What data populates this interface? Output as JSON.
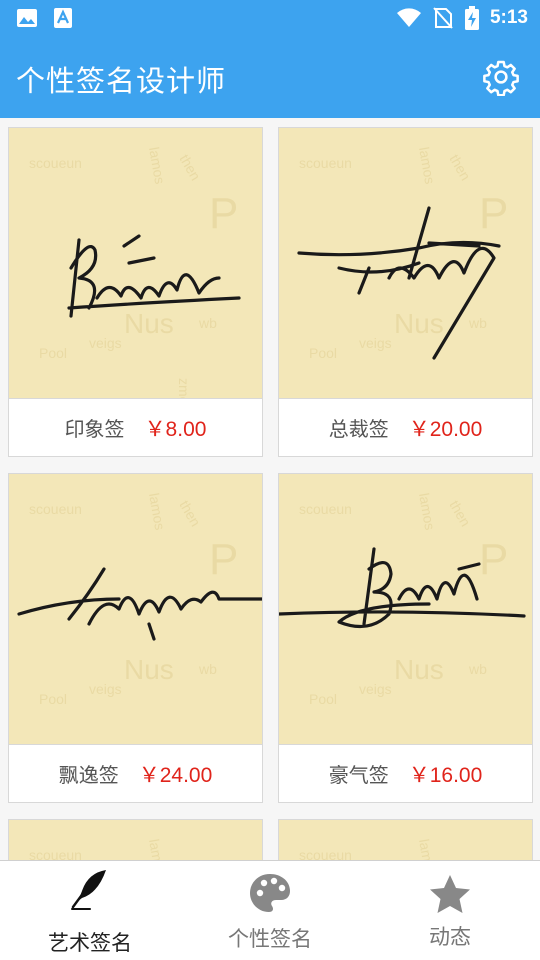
{
  "status_bar": {
    "time": "5:13",
    "icons": [
      "image-icon",
      "font-icon",
      "wifi-icon",
      "no-sim-icon",
      "battery-charging-icon"
    ]
  },
  "app_bar": {
    "title": "个性签名设计师",
    "settings_icon": "gear-icon"
  },
  "products": [
    {
      "name": "印象签",
      "price": "￥8.00"
    },
    {
      "name": "总裁签",
      "price": "￥20.00"
    },
    {
      "name": "飘逸签",
      "price": "￥24.00"
    },
    {
      "name": "豪气签",
      "price": "￥16.00"
    }
  ],
  "bottom_nav": {
    "items": [
      {
        "label": "艺术签名",
        "icon": "quill-icon",
        "active": true
      },
      {
        "label": "个性签名",
        "icon": "palette-icon",
        "active": false
      },
      {
        "label": "动态",
        "icon": "star-icon",
        "active": false
      }
    ]
  },
  "colors": {
    "primary": "#3da3ef",
    "price": "#e0241b",
    "card_background": "#f3e7b8",
    "signature_ink": "#1a1a1a"
  }
}
